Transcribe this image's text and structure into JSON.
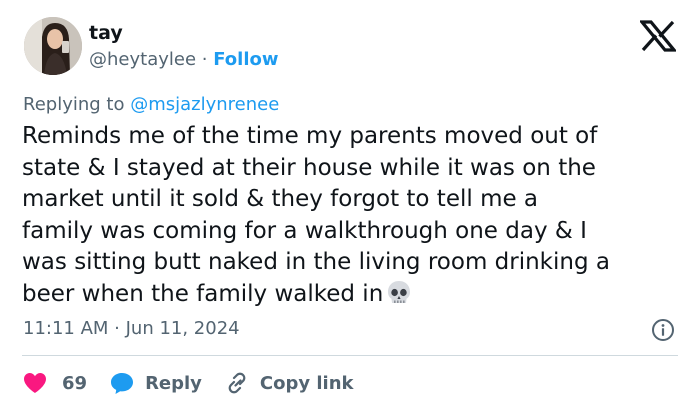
{
  "author": {
    "name": "tay",
    "handle": "@heytaylee",
    "separator": "·",
    "follow_label": "Follow"
  },
  "reply_context": {
    "prefix": "Replying to",
    "mention": "@msjazlynrenee"
  },
  "tweet": {
    "lines": [
      "Reminds me of the time my parents moved out of",
      "state & I stayed at their house while it was on the",
      "market until it sold & they forgot to tell me a",
      "family was coming for a walkthrough one day & I",
      "was sitting butt naked in the living room drinking a",
      "beer when the family walked in"
    ],
    "emoji": "skull"
  },
  "meta": {
    "timestamp": "11:11 AM · Jun 11, 2024"
  },
  "actions": {
    "like_count": "69",
    "reply_label": "Reply",
    "copy_link_label": "Copy link"
  },
  "colors": {
    "accent": "#1d9bf0",
    "like": "#f91880",
    "secondary_text": "#536471",
    "primary_text": "#0f1419",
    "divider": "#cfd9de"
  },
  "icons": {
    "platform": "x-logo-icon",
    "info": "info-icon",
    "like": "heart-icon",
    "reply": "speech-bubble-icon",
    "copy_link": "link-icon"
  }
}
